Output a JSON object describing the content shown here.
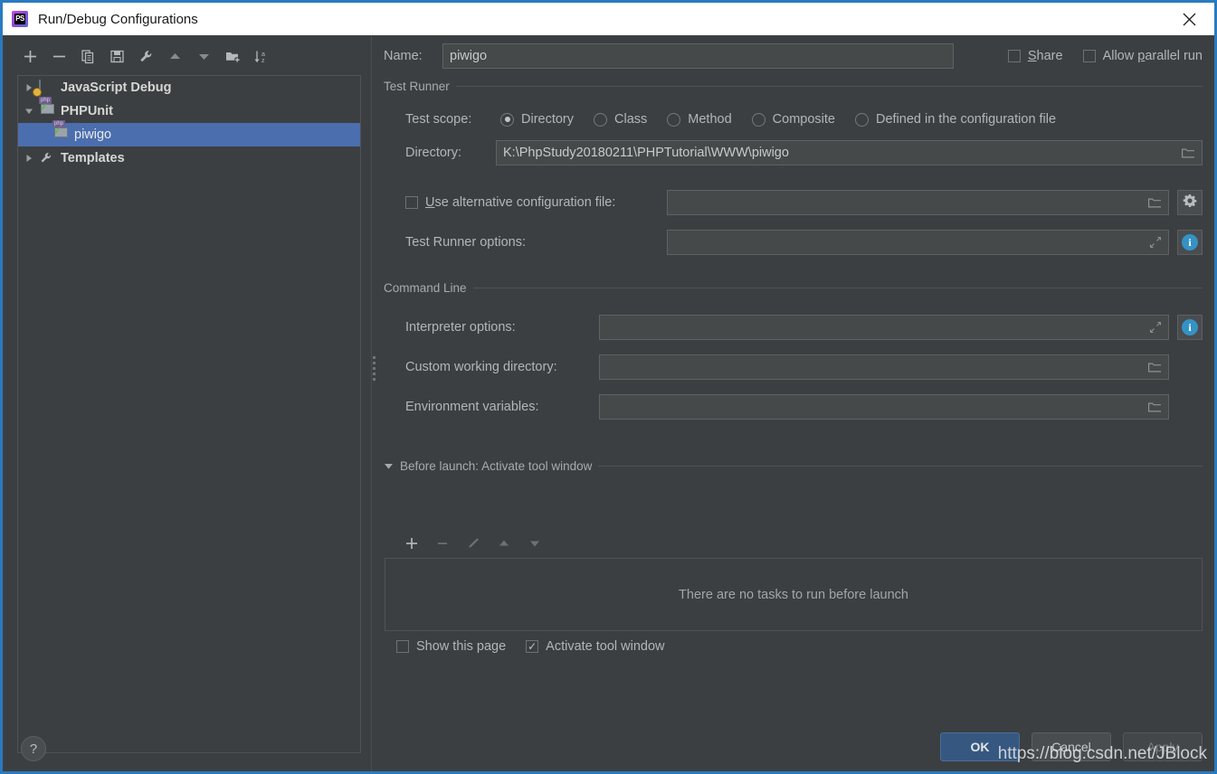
{
  "window": {
    "title": "Run/Debug Configurations",
    "logo_text": "PS",
    "close_icon": "close-icon",
    "accent_border": "#2a7ac0",
    "background": "#3c3f41",
    "selection_color": "#4b6eaf",
    "info_icon_color": "#3592c4",
    "ok_button_color": "#365880"
  },
  "left_panel": {
    "toolbar": [
      {
        "name": "add-configuration-button",
        "icon": "plus-icon",
        "tooltip": "Add New Configuration"
      },
      {
        "name": "remove-configuration-button",
        "icon": "minus-icon",
        "tooltip": "Remove Configuration"
      },
      {
        "name": "copy-configuration-button",
        "icon": "copy-icon",
        "tooltip": "Copy Configuration"
      },
      {
        "name": "save-configuration-button",
        "icon": "save-icon",
        "tooltip": "Save Configuration"
      },
      {
        "name": "edit-templates-button",
        "icon": "wrench-icon",
        "tooltip": "Edit Templates"
      },
      {
        "name": "move-up-button",
        "icon": "arrow-up-icon",
        "tooltip": "Move Up"
      },
      {
        "name": "move-down-button",
        "icon": "arrow-down-icon",
        "tooltip": "Move Down"
      },
      {
        "name": "new-folder-button",
        "icon": "new-folder-icon",
        "tooltip": "Create New Folder"
      },
      {
        "name": "sort-button",
        "icon": "sort-az-icon",
        "tooltip": "Sort Configurations"
      }
    ],
    "tree": [
      {
        "label": "JavaScript Debug",
        "level": 1,
        "expanded": false,
        "selected": false,
        "icon": "javascript-debug-icon",
        "has_twisty": true
      },
      {
        "label": "PHPUnit",
        "level": 1,
        "expanded": true,
        "selected": false,
        "icon": "phpunit-icon",
        "has_twisty": true
      },
      {
        "label": "piwigo",
        "level": 2,
        "expanded": false,
        "selected": true,
        "icon": "phpunit-icon",
        "has_twisty": false
      },
      {
        "label": "Templates",
        "level": 1,
        "expanded": false,
        "selected": false,
        "icon": "wrench-icon",
        "has_twisty": true
      }
    ],
    "help_button": "?"
  },
  "right_panel": {
    "name_label": "Name:",
    "name_value": "piwigo",
    "share": {
      "label": "Share",
      "mnemonic": "S",
      "checked": false
    },
    "allow_parallel_run": {
      "label": "Allow parallel run",
      "mnemonic": "p",
      "checked": false
    },
    "test_runner": {
      "group_title": "Test Runner",
      "test_scope_label": "Test scope:",
      "scope_options": [
        {
          "label": "Directory",
          "selected": true
        },
        {
          "label": "Class",
          "selected": false
        },
        {
          "label": "Method",
          "selected": false
        },
        {
          "label": "Composite",
          "selected": false
        },
        {
          "label": "Defined in the configuration file",
          "selected": false
        }
      ],
      "directory_label": "Directory:",
      "directory_value": "K:\\PhpStudy20180211\\PHPTutorial\\WWW\\piwigo",
      "alt_config": {
        "label": "Use alternative configuration file:",
        "mnemonic": "U",
        "checked": false,
        "value": ""
      },
      "alt_config_gear_icon": "gear-icon",
      "test_runner_options_label": "Test Runner options:",
      "test_runner_options_value": "",
      "test_runner_options_info_icon": "info-icon",
      "expand_icon": "expand-arrow-icon",
      "browse_icon": "folder-browse-icon"
    },
    "command_line": {
      "group_title": "Command Line",
      "interpreter_options_label": "Interpreter options:",
      "interpreter_options_value": "",
      "interpreter_options_info_icon": "info-icon",
      "custom_working_directory_label": "Custom working directory:",
      "custom_working_directory_value": "",
      "environment_variables_label": "Environment variables:",
      "environment_variables_value": ""
    },
    "before_launch": {
      "group_title": "Before launch: Activate tool window",
      "collapse_icon": "triangle-down-icon",
      "toolbar": [
        {
          "name": "add-task-button",
          "icon": "plus-icon",
          "enabled": true
        },
        {
          "name": "remove-task-button",
          "icon": "minus-icon",
          "enabled": false
        },
        {
          "name": "edit-task-button",
          "icon": "pencil-icon",
          "enabled": false
        },
        {
          "name": "move-task-up-button",
          "icon": "arrow-up-icon",
          "enabled": false
        },
        {
          "name": "move-task-down-button",
          "icon": "arrow-down-icon",
          "enabled": false
        }
      ],
      "empty_text": "There are no tasks to run before launch",
      "show_this_page": {
        "label": "Show this page",
        "checked": false
      },
      "activate_tool_window": {
        "label": "Activate tool window",
        "checked": true
      }
    },
    "buttons": {
      "ok": "OK",
      "cancel": "Cancel",
      "apply": "Apply"
    }
  },
  "watermark": "https://blog.csdn.net/JBlock"
}
